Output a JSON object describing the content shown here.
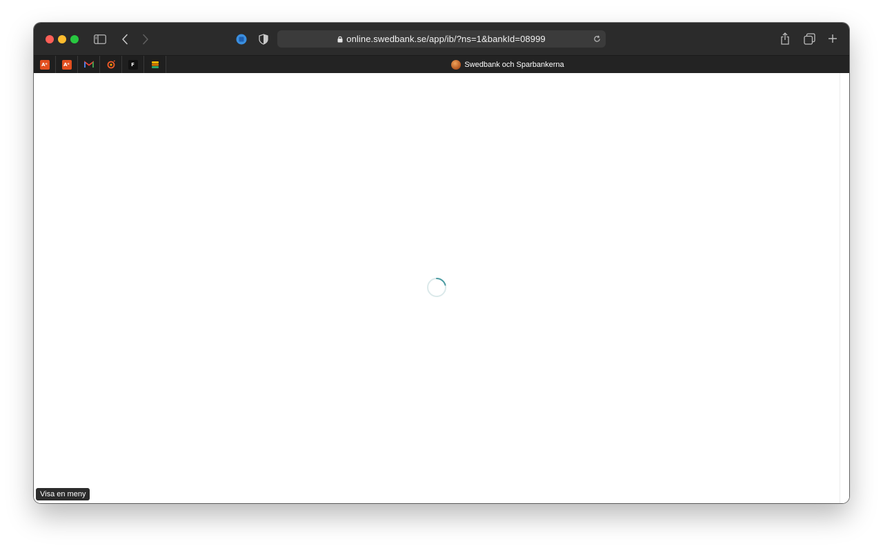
{
  "browser": {
    "address_bar": {
      "url": "online.swedbank.se/app/ib/?ns=1&bankId=08999"
    },
    "active_tab": {
      "title": "Swedbank och Sparbankerna"
    },
    "bookmarks": [
      {
        "icon": "adobe-icon",
        "label": "Aᵉ",
        "color": "#e34f1f"
      },
      {
        "icon": "adobe-icon",
        "label": "Aᵉ",
        "color": "#e34f1f"
      },
      {
        "icon": "gmail-icon",
        "label": "M",
        "color": "#ea4335"
      },
      {
        "icon": "grafana-icon",
        "label": "",
        "color": "#f05a28"
      },
      {
        "icon": "figma-icon",
        "label": "F",
        "color": "#ffffff"
      },
      {
        "icon": "stack-icon",
        "label": "",
        "color": "#f5b300"
      }
    ]
  },
  "page": {
    "status_tooltip": "Visa en meny"
  },
  "colors": {
    "toolbar": "#2b2b2b",
    "spinner": "#4a9aa1"
  }
}
